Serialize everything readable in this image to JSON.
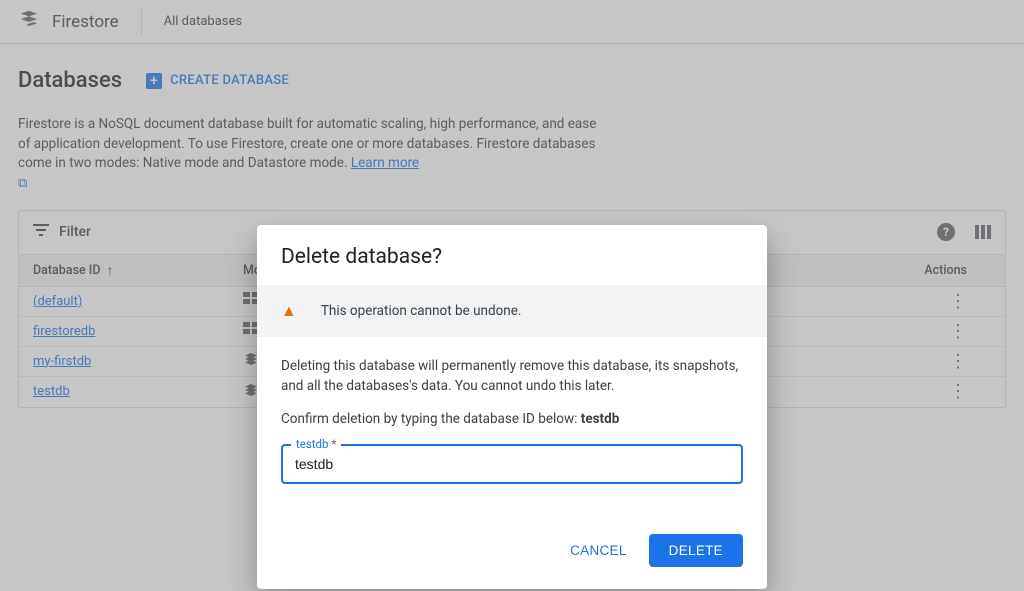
{
  "header": {
    "app_title": "Firestore",
    "tab_all_databases": "All databases"
  },
  "page": {
    "title": "Databases",
    "create_label": "CREATE DATABASE",
    "description_part1": "Firestore is a NoSQL document database built for automatic scaling, high performance, and ease of application development. To use Firestore, create one or more databases. Firestore databases come in two modes: Native mode and Datastore mode. ",
    "learn_more": "Learn more"
  },
  "table": {
    "filter_label": "Filter",
    "columns": {
      "db_id": "Database ID",
      "mode": "Mode",
      "actions": "Actions"
    },
    "rows": [
      {
        "id": "(default)"
      },
      {
        "id": "firestoredb"
      },
      {
        "id": "my-firstdb"
      },
      {
        "id": "testdb"
      }
    ]
  },
  "modal": {
    "title": "Delete database?",
    "warning": "This operation cannot be undone.",
    "body": "Deleting this database will permanently remove this database, its snapshots, and all the databases's data. You cannot undo this later.",
    "confirm_prefix": "Confirm deletion by typing the database ID below: ",
    "confirm_target": "testdb",
    "field_label": "testdb",
    "input_value": "testdb",
    "cancel_label": "CANCEL",
    "delete_label": "DELETE"
  }
}
